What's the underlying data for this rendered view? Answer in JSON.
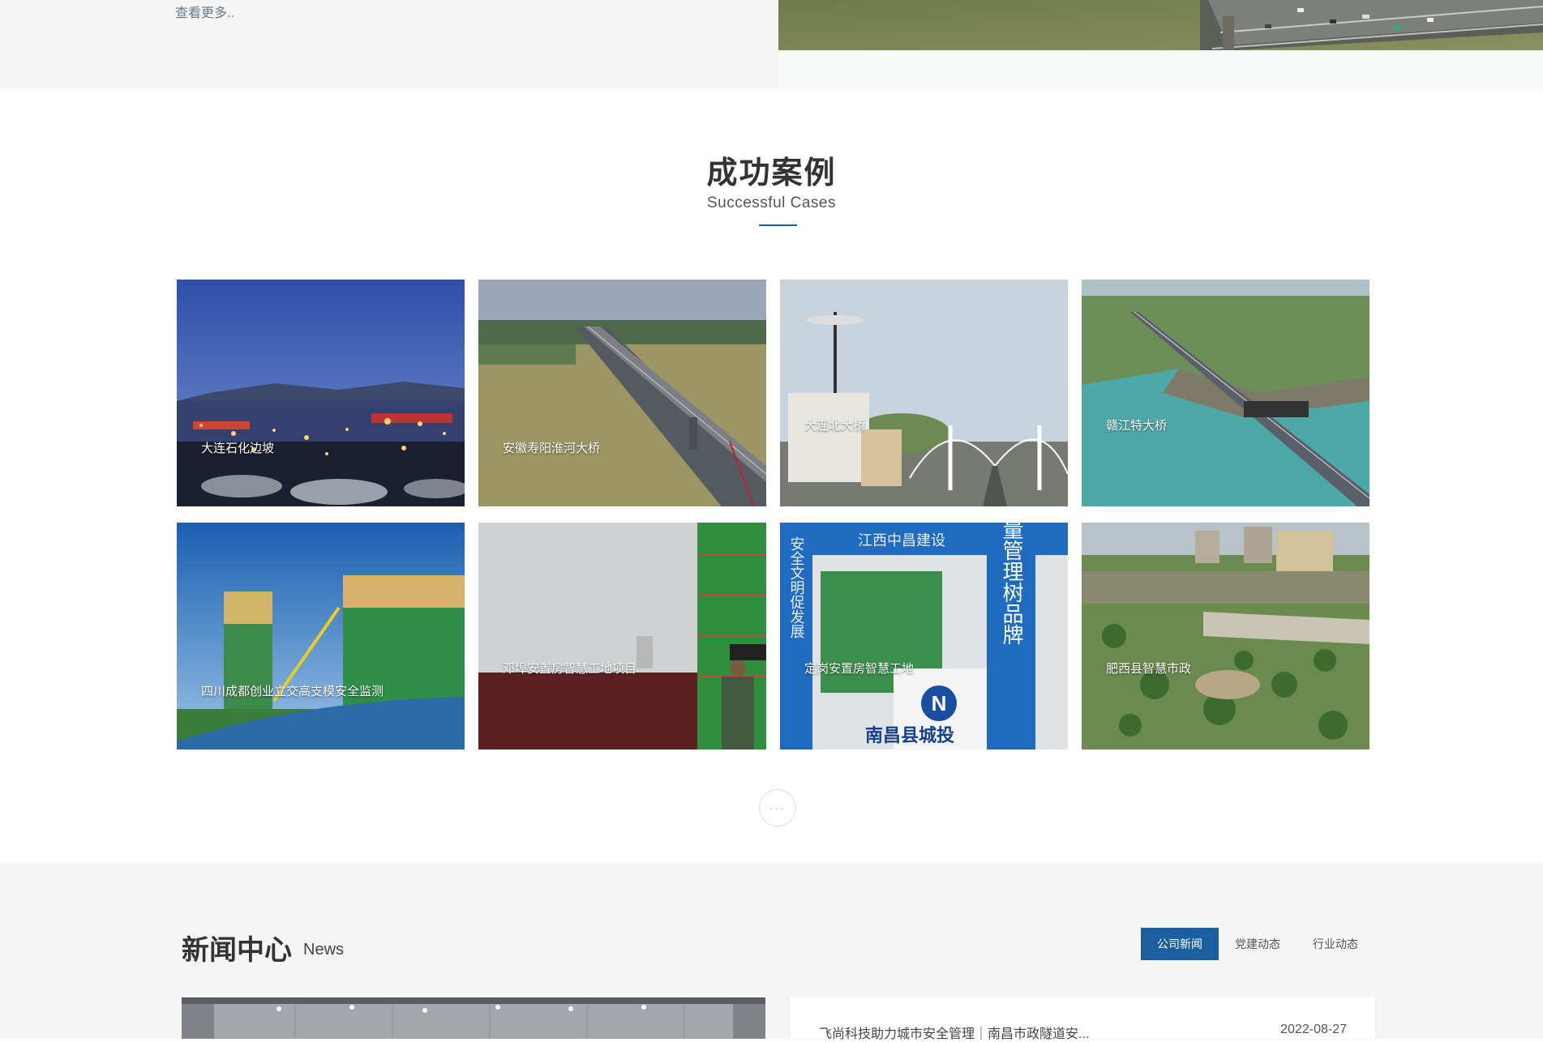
{
  "top": {
    "more_label": "查看更多.."
  },
  "cases": {
    "title": "成功案例",
    "subtitle": "Successful Cases",
    "items": [
      {
        "label": "大连石化边坡"
      },
      {
        "label": "安徽寿阳淮河大桥"
      },
      {
        "label": "大连北大桥"
      },
      {
        "label": "赣江特大桥"
      },
      {
        "label": "四川成都创业立交高支模安全监测"
      },
      {
        "label": "邓埠安置房智慧工地项目"
      },
      {
        "label": "定岗安置房智慧工地"
      },
      {
        "label": "肥西县智慧市政"
      }
    ],
    "more_symbol": "···",
    "sign_text_1": "质量管理树品牌",
    "sign_text_2": "南昌县城投",
    "sign_text_3": "安全文明促发展",
    "sign_text_4": "江西中昌建设"
  },
  "news": {
    "title": "新闻中心",
    "title_en": "News",
    "tabs": [
      {
        "label": "公司新闻",
        "active": true
      },
      {
        "label": "党建动态",
        "active": false
      },
      {
        "label": "行业动态",
        "active": false
      }
    ],
    "items": [
      {
        "title": "飞尚科技助力城市安全管理｜南昌市政隧道安...",
        "date": "2022-08-27"
      }
    ]
  },
  "colors": {
    "accent": "#1a5fa0",
    "section_bg": "#f5f5f5"
  }
}
